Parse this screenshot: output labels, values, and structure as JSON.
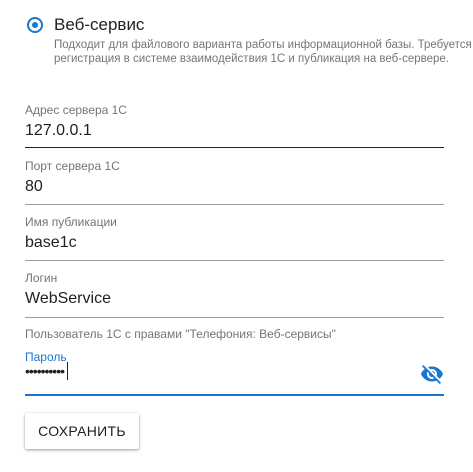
{
  "radio": {
    "label": "Веб-сервис",
    "selected": true,
    "hint": "Подходит для файлового варианта работы информационной базы. Требуется регистрация в системе взаимодействия 1С и публикация на веб-сервере."
  },
  "fields": {
    "server": {
      "label": "Адрес сервера 1С",
      "value": "127.0.0.1"
    },
    "port": {
      "label": "Порт сервера 1С",
      "value": "80"
    },
    "publication": {
      "label": "Имя публикации",
      "value": "base1c"
    },
    "login": {
      "label": "Логин",
      "value": "WebService"
    },
    "password": {
      "label": "Пароль",
      "masked_value": "••••••••••"
    }
  },
  "note": "Пользователь 1С с правами \"Телефония: Веб-сервисы\"",
  "save_button": {
    "label": "СОХРАНИТЬ"
  },
  "colors": {
    "accent": "#1976d2",
    "text": "#212121",
    "muted": "#757575",
    "divider": "#9e9e9e"
  },
  "icons": {
    "password_toggle": "eye-off-icon"
  }
}
